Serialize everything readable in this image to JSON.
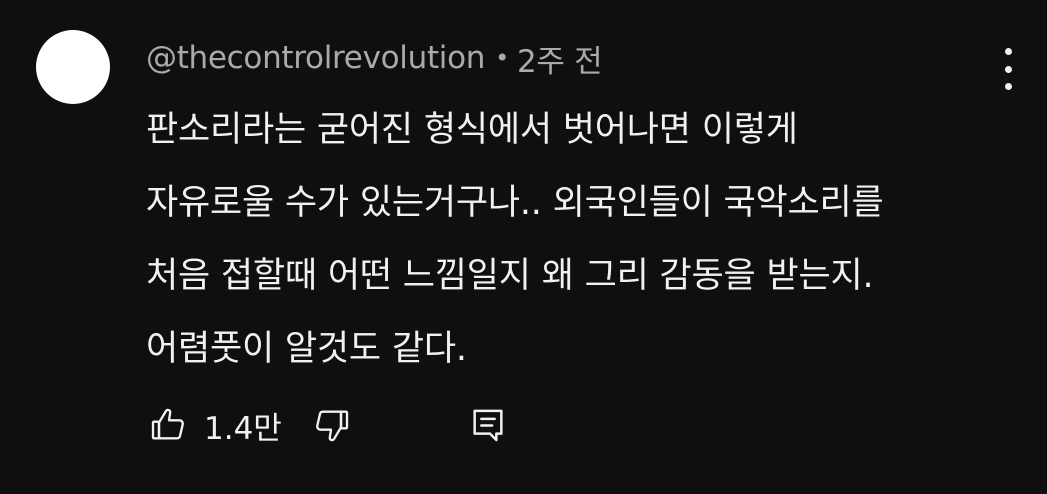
{
  "comment": {
    "author": "@thecontrolrevolution",
    "separator": "•",
    "time": "2주 전",
    "text_lines": [
      "판소리라는 굳어진 형식에서 벗어나면 이렇게",
      "자유로울 수가 있는거구나.. 외국인들이 국악소리를",
      "처음 접할때 어떤 느낌일지 왜 그리 감동을 받는지.",
      "어렴풋이 알것도 같다."
    ],
    "like_count": "1.4만"
  },
  "icons": {
    "menu": "more-vertical-icon",
    "like": "thumb-up-icon",
    "dislike": "thumb-down-icon",
    "reply": "comment-reply-icon"
  },
  "colors": {
    "background": "#0f0f0f",
    "text": "#f1f1f1",
    "meta": "#aaaaaa",
    "avatar": "#ffffff"
  }
}
